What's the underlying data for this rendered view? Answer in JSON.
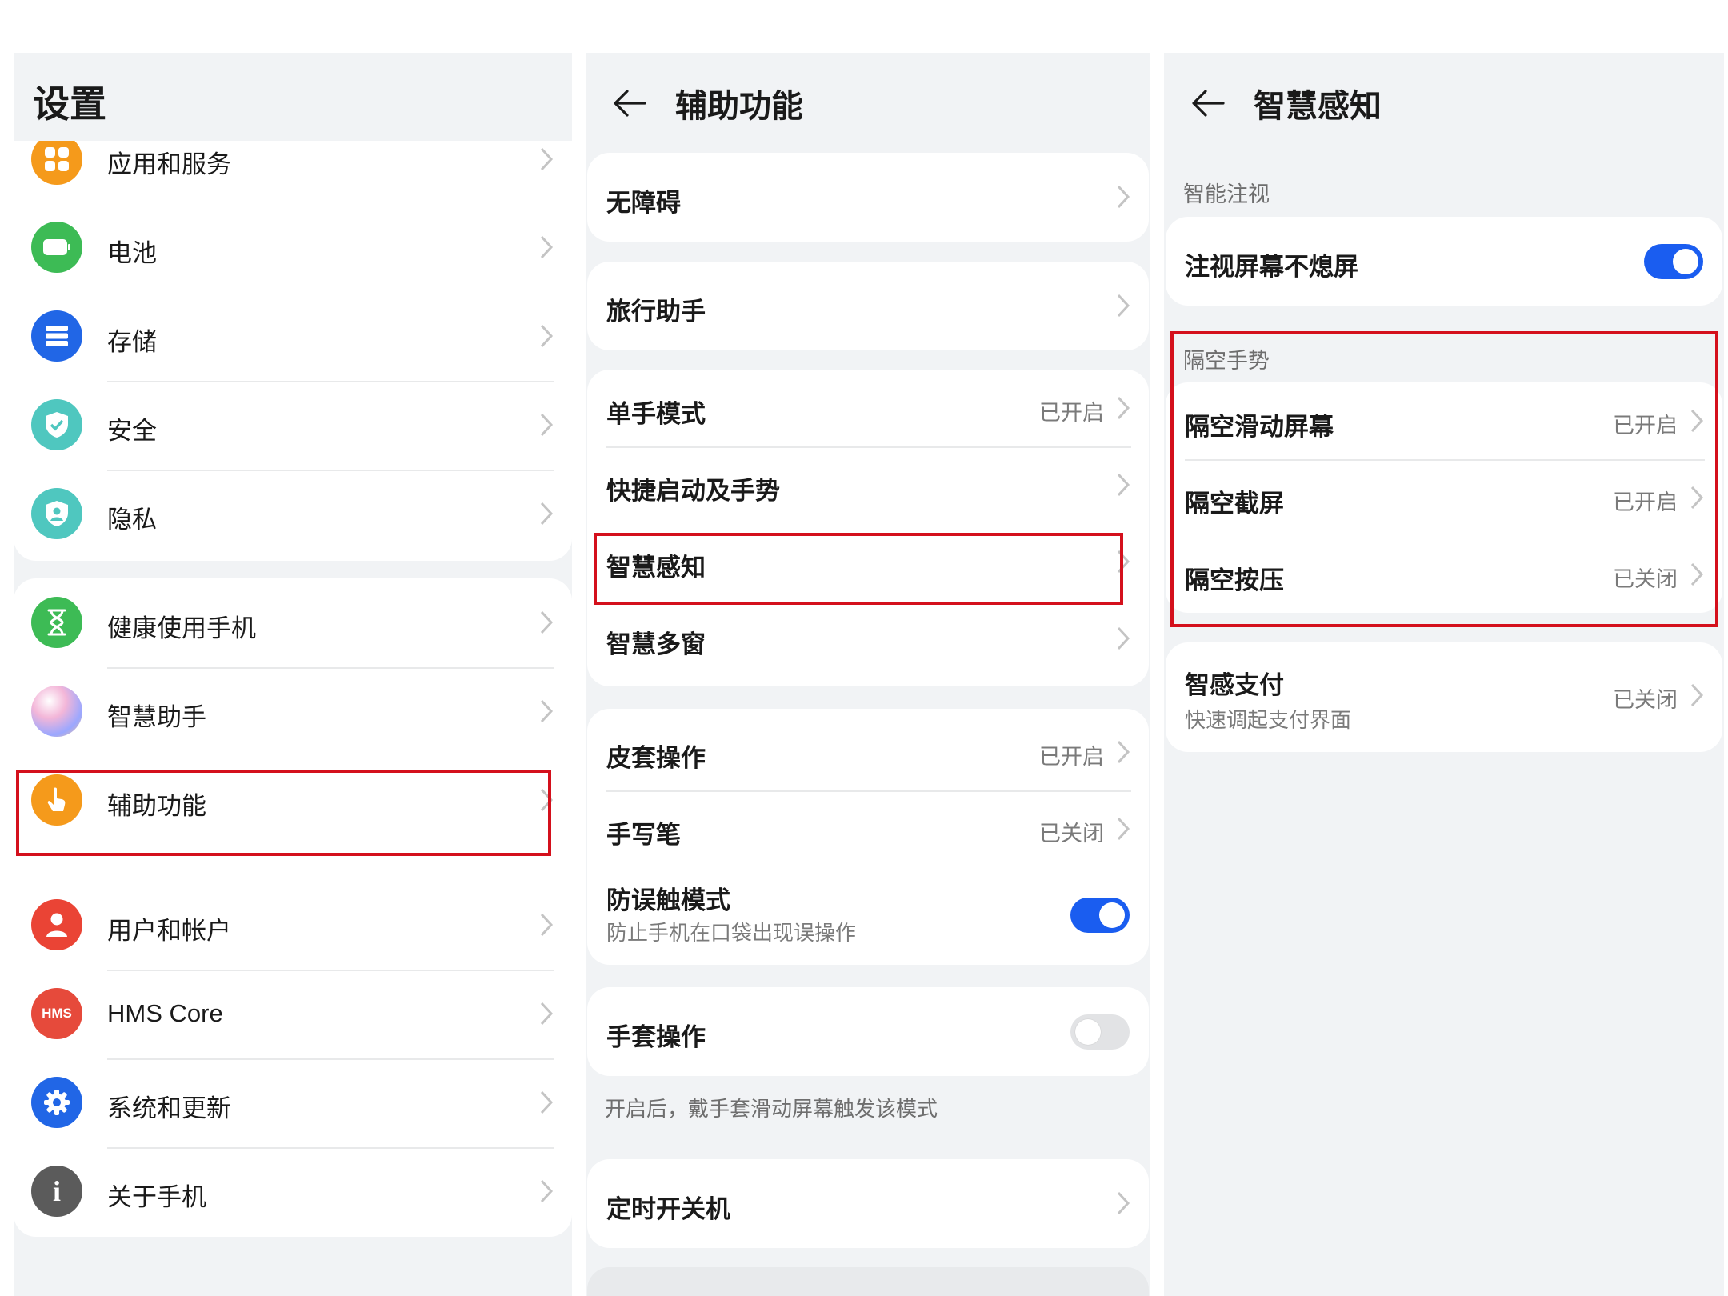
{
  "settings": {
    "title": "设置",
    "items": [
      {
        "label": "应用和服务",
        "icon": "apps-icon",
        "color": "#f59a1b"
      },
      {
        "label": "电池",
        "icon": "battery-icon",
        "color": "#3dbb55"
      },
      {
        "label": "存储",
        "icon": "storage-icon",
        "color": "#2166e6"
      },
      {
        "label": "安全",
        "icon": "security-shield-icon",
        "color": "#4fc7bf"
      },
      {
        "label": "隐私",
        "icon": "privacy-shield-icon",
        "color": "#4fc7bf"
      },
      {
        "label": "健康使用手机",
        "icon": "hourglass-icon",
        "color": "#3dbb55"
      },
      {
        "label": "智慧助手",
        "icon": "assistant-orb-icon",
        "color": "#9aa7ff"
      },
      {
        "label": "辅助功能",
        "icon": "hand-pointer-icon",
        "color": "#f59a1b"
      },
      {
        "label": "用户和帐户",
        "icon": "user-icon",
        "color": "#ea4435"
      },
      {
        "label": "HMS Core",
        "icon": "hms-icon",
        "color": "#e64a3b"
      },
      {
        "label": "系统和更新",
        "icon": "gear-icon",
        "color": "#2166e6"
      },
      {
        "label": "关于手机",
        "icon": "info-icon",
        "color": "#5b5b5b"
      }
    ],
    "hms_badge": "HMS"
  },
  "accessibility": {
    "title": "辅助功能",
    "items": [
      {
        "label": "无障碍",
        "value": ""
      },
      {
        "label": "旅行助手",
        "value": ""
      },
      {
        "label": "单手模式",
        "value": "已开启"
      },
      {
        "label": "快捷启动及手势",
        "value": ""
      },
      {
        "label": "智慧感知",
        "value": ""
      },
      {
        "label": "智慧多窗",
        "value": ""
      },
      {
        "label": "皮套操作",
        "value": "已开启"
      },
      {
        "label": "手写笔",
        "value": "已关闭"
      },
      {
        "label": "防误触模式",
        "sub": "防止手机在口袋出现误操作",
        "toggle": true
      },
      {
        "label": "手套操作",
        "toggle": false
      },
      {
        "label": "定时开关机",
        "value": ""
      }
    ],
    "glove_note": "开启后，戴手套滑动屏幕触发该模式"
  },
  "smart_perception": {
    "title": "智慧感知",
    "section_gaze": "智能注视",
    "gaze_item": {
      "label": "注视屏幕不熄屏",
      "toggle": true
    },
    "section_gesture": "隔空手势",
    "gesture_items": [
      {
        "label": "隔空滑动屏幕",
        "value": "已开启"
      },
      {
        "label": "隔空截屏",
        "value": "已开启"
      },
      {
        "label": "隔空按压",
        "value": "已关闭"
      }
    ],
    "pay": {
      "label": "智感支付",
      "sub": "快速调起支付界面",
      "value": "已关闭"
    }
  },
  "colors": {
    "accent": "#1a5df0",
    "highlight": "#d4101c",
    "background": "#f1f3f5"
  }
}
